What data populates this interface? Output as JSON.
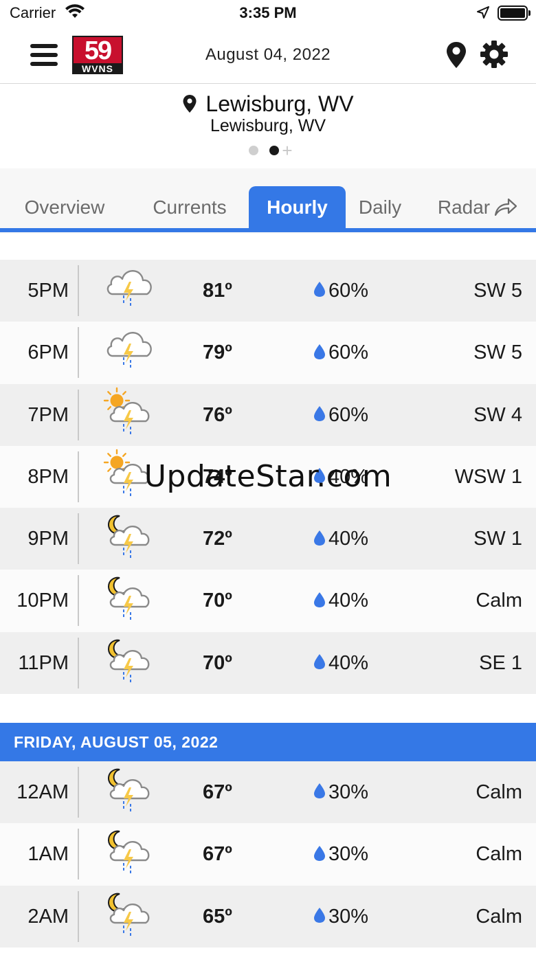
{
  "status_bar": {
    "carrier": "Carrier",
    "time": "3:35 PM"
  },
  "header": {
    "date": "August 04, 2022",
    "logo_number": "59",
    "logo_callsign": "WVNS"
  },
  "location": {
    "name": "Lewisburg, WV",
    "subtitle": "Lewisburg, WV",
    "page_dots": [
      "inactive",
      "active"
    ],
    "add_symbol": "+"
  },
  "tabs": [
    {
      "label": "Overview",
      "active": false
    },
    {
      "label": "Currents",
      "active": false
    },
    {
      "label": "Hourly",
      "active": true
    },
    {
      "label": "Daily",
      "active": false
    },
    {
      "label": "Radar",
      "active": false
    }
  ],
  "today_hours": [
    {
      "time": "5PM",
      "icon": "thunderstorm-cloud-icon",
      "temp": "81º",
      "precip": "60%",
      "wind": "SW 5"
    },
    {
      "time": "6PM",
      "icon": "thunderstorm-cloud-icon",
      "temp": "79º",
      "precip": "60%",
      "wind": "SW 5"
    },
    {
      "time": "7PM",
      "icon": "sun-thunderstorm-icon",
      "temp": "76º",
      "precip": "60%",
      "wind": "SW 4"
    },
    {
      "time": "8PM",
      "icon": "sun-thunderstorm-icon",
      "temp": "74º",
      "precip": "40%",
      "wind": "WSW 1"
    },
    {
      "time": "9PM",
      "icon": "moon-thunderstorm-icon",
      "temp": "72º",
      "precip": "40%",
      "wind": "SW 1"
    },
    {
      "time": "10PM",
      "icon": "moon-thunderstorm-icon",
      "temp": "70º",
      "precip": "40%",
      "wind": "Calm"
    },
    {
      "time": "11PM",
      "icon": "moon-thunderstorm-icon",
      "temp": "70º",
      "precip": "40%",
      "wind": "SE 1"
    }
  ],
  "next_day": {
    "header": "FRIDAY, AUGUST 05, 2022",
    "hours": [
      {
        "time": "12AM",
        "icon": "moon-thunderstorm-icon",
        "temp": "67º",
        "precip": "30%",
        "wind": "Calm"
      },
      {
        "time": "1AM",
        "icon": "moon-thunderstorm-icon",
        "temp": "67º",
        "precip": "30%",
        "wind": "Calm"
      },
      {
        "time": "2AM",
        "icon": "moon-thunderstorm-icon",
        "temp": "65º",
        "precip": "30%",
        "wind": "Calm"
      }
    ]
  },
  "watermark": "UpdateStar.com",
  "colors": {
    "accent": "#3478e6",
    "logo_red": "#c8102e",
    "row_alt": "#efefef",
    "sun": "#f5a623",
    "moon": "#f2c230",
    "bolt": "#f7c948",
    "rain": "#3a78e6"
  }
}
